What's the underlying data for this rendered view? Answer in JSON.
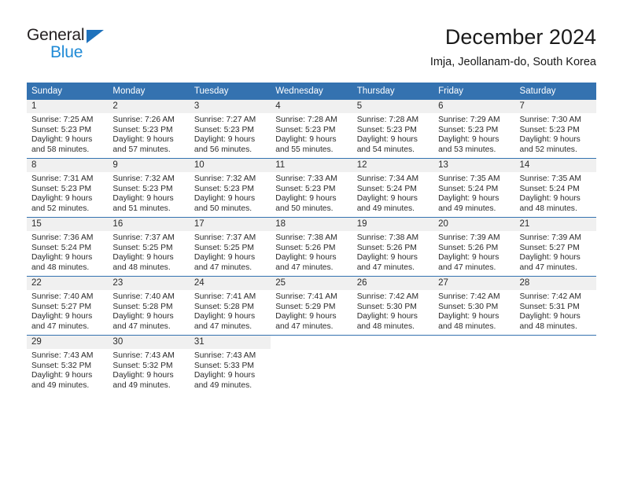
{
  "logo": {
    "word_top": "General",
    "word_bottom": "Blue",
    "triangle_icon": "blue-triangle-icon",
    "color_dark": "#231f20",
    "color_blue": "#1f8ad6"
  },
  "header": {
    "title": "December 2024",
    "subtitle": "Imja, Jeollanam-do, South Korea"
  },
  "theme": {
    "header_bg": "#3472b0",
    "daynum_bg": "#f0f0f0",
    "separator": "#3472b0",
    "text": "#2b2b2b"
  },
  "weekday_headers": [
    "Sunday",
    "Monday",
    "Tuesday",
    "Wednesday",
    "Thursday",
    "Friday",
    "Saturday"
  ],
  "weeks": [
    [
      {
        "day": "1",
        "sunrise": "Sunrise: 7:25 AM",
        "sunset": "Sunset: 5:23 PM",
        "daylight1": "Daylight: 9 hours",
        "daylight2": "and 58 minutes."
      },
      {
        "day": "2",
        "sunrise": "Sunrise: 7:26 AM",
        "sunset": "Sunset: 5:23 PM",
        "daylight1": "Daylight: 9 hours",
        "daylight2": "and 57 minutes."
      },
      {
        "day": "3",
        "sunrise": "Sunrise: 7:27 AM",
        "sunset": "Sunset: 5:23 PM",
        "daylight1": "Daylight: 9 hours",
        "daylight2": "and 56 minutes."
      },
      {
        "day": "4",
        "sunrise": "Sunrise: 7:28 AM",
        "sunset": "Sunset: 5:23 PM",
        "daylight1": "Daylight: 9 hours",
        "daylight2": "and 55 minutes."
      },
      {
        "day": "5",
        "sunrise": "Sunrise: 7:28 AM",
        "sunset": "Sunset: 5:23 PM",
        "daylight1": "Daylight: 9 hours",
        "daylight2": "and 54 minutes."
      },
      {
        "day": "6",
        "sunrise": "Sunrise: 7:29 AM",
        "sunset": "Sunset: 5:23 PM",
        "daylight1": "Daylight: 9 hours",
        "daylight2": "and 53 minutes."
      },
      {
        "day": "7",
        "sunrise": "Sunrise: 7:30 AM",
        "sunset": "Sunset: 5:23 PM",
        "daylight1": "Daylight: 9 hours",
        "daylight2": "and 52 minutes."
      }
    ],
    [
      {
        "day": "8",
        "sunrise": "Sunrise: 7:31 AM",
        "sunset": "Sunset: 5:23 PM",
        "daylight1": "Daylight: 9 hours",
        "daylight2": "and 52 minutes."
      },
      {
        "day": "9",
        "sunrise": "Sunrise: 7:32 AM",
        "sunset": "Sunset: 5:23 PM",
        "daylight1": "Daylight: 9 hours",
        "daylight2": "and 51 minutes."
      },
      {
        "day": "10",
        "sunrise": "Sunrise: 7:32 AM",
        "sunset": "Sunset: 5:23 PM",
        "daylight1": "Daylight: 9 hours",
        "daylight2": "and 50 minutes."
      },
      {
        "day": "11",
        "sunrise": "Sunrise: 7:33 AM",
        "sunset": "Sunset: 5:23 PM",
        "daylight1": "Daylight: 9 hours",
        "daylight2": "and 50 minutes."
      },
      {
        "day": "12",
        "sunrise": "Sunrise: 7:34 AM",
        "sunset": "Sunset: 5:24 PM",
        "daylight1": "Daylight: 9 hours",
        "daylight2": "and 49 minutes."
      },
      {
        "day": "13",
        "sunrise": "Sunrise: 7:35 AM",
        "sunset": "Sunset: 5:24 PM",
        "daylight1": "Daylight: 9 hours",
        "daylight2": "and 49 minutes."
      },
      {
        "day": "14",
        "sunrise": "Sunrise: 7:35 AM",
        "sunset": "Sunset: 5:24 PM",
        "daylight1": "Daylight: 9 hours",
        "daylight2": "and 48 minutes."
      }
    ],
    [
      {
        "day": "15",
        "sunrise": "Sunrise: 7:36 AM",
        "sunset": "Sunset: 5:24 PM",
        "daylight1": "Daylight: 9 hours",
        "daylight2": "and 48 minutes."
      },
      {
        "day": "16",
        "sunrise": "Sunrise: 7:37 AM",
        "sunset": "Sunset: 5:25 PM",
        "daylight1": "Daylight: 9 hours",
        "daylight2": "and 48 minutes."
      },
      {
        "day": "17",
        "sunrise": "Sunrise: 7:37 AM",
        "sunset": "Sunset: 5:25 PM",
        "daylight1": "Daylight: 9 hours",
        "daylight2": "and 47 minutes."
      },
      {
        "day": "18",
        "sunrise": "Sunrise: 7:38 AM",
        "sunset": "Sunset: 5:26 PM",
        "daylight1": "Daylight: 9 hours",
        "daylight2": "and 47 minutes."
      },
      {
        "day": "19",
        "sunrise": "Sunrise: 7:38 AM",
        "sunset": "Sunset: 5:26 PM",
        "daylight1": "Daylight: 9 hours",
        "daylight2": "and 47 minutes."
      },
      {
        "day": "20",
        "sunrise": "Sunrise: 7:39 AM",
        "sunset": "Sunset: 5:26 PM",
        "daylight1": "Daylight: 9 hours",
        "daylight2": "and 47 minutes."
      },
      {
        "day": "21",
        "sunrise": "Sunrise: 7:39 AM",
        "sunset": "Sunset: 5:27 PM",
        "daylight1": "Daylight: 9 hours",
        "daylight2": "and 47 minutes."
      }
    ],
    [
      {
        "day": "22",
        "sunrise": "Sunrise: 7:40 AM",
        "sunset": "Sunset: 5:27 PM",
        "daylight1": "Daylight: 9 hours",
        "daylight2": "and 47 minutes."
      },
      {
        "day": "23",
        "sunrise": "Sunrise: 7:40 AM",
        "sunset": "Sunset: 5:28 PM",
        "daylight1": "Daylight: 9 hours",
        "daylight2": "and 47 minutes."
      },
      {
        "day": "24",
        "sunrise": "Sunrise: 7:41 AM",
        "sunset": "Sunset: 5:28 PM",
        "daylight1": "Daylight: 9 hours",
        "daylight2": "and 47 minutes."
      },
      {
        "day": "25",
        "sunrise": "Sunrise: 7:41 AM",
        "sunset": "Sunset: 5:29 PM",
        "daylight1": "Daylight: 9 hours",
        "daylight2": "and 47 minutes."
      },
      {
        "day": "26",
        "sunrise": "Sunrise: 7:42 AM",
        "sunset": "Sunset: 5:30 PM",
        "daylight1": "Daylight: 9 hours",
        "daylight2": "and 48 minutes."
      },
      {
        "day": "27",
        "sunrise": "Sunrise: 7:42 AM",
        "sunset": "Sunset: 5:30 PM",
        "daylight1": "Daylight: 9 hours",
        "daylight2": "and 48 minutes."
      },
      {
        "day": "28",
        "sunrise": "Sunrise: 7:42 AM",
        "sunset": "Sunset: 5:31 PM",
        "daylight1": "Daylight: 9 hours",
        "daylight2": "and 48 minutes."
      }
    ],
    [
      {
        "day": "29",
        "sunrise": "Sunrise: 7:43 AM",
        "sunset": "Sunset: 5:32 PM",
        "daylight1": "Daylight: 9 hours",
        "daylight2": "and 49 minutes."
      },
      {
        "day": "30",
        "sunrise": "Sunrise: 7:43 AM",
        "sunset": "Sunset: 5:32 PM",
        "daylight1": "Daylight: 9 hours",
        "daylight2": "and 49 minutes."
      },
      {
        "day": "31",
        "sunrise": "Sunrise: 7:43 AM",
        "sunset": "Sunset: 5:33 PM",
        "daylight1": "Daylight: 9 hours",
        "daylight2": "and 49 minutes."
      },
      {
        "day": "",
        "sunrise": "",
        "sunset": "",
        "daylight1": "",
        "daylight2": ""
      },
      {
        "day": "",
        "sunrise": "",
        "sunset": "",
        "daylight1": "",
        "daylight2": ""
      },
      {
        "day": "",
        "sunrise": "",
        "sunset": "",
        "daylight1": "",
        "daylight2": ""
      },
      {
        "day": "",
        "sunrise": "",
        "sunset": "",
        "daylight1": "",
        "daylight2": ""
      }
    ]
  ]
}
